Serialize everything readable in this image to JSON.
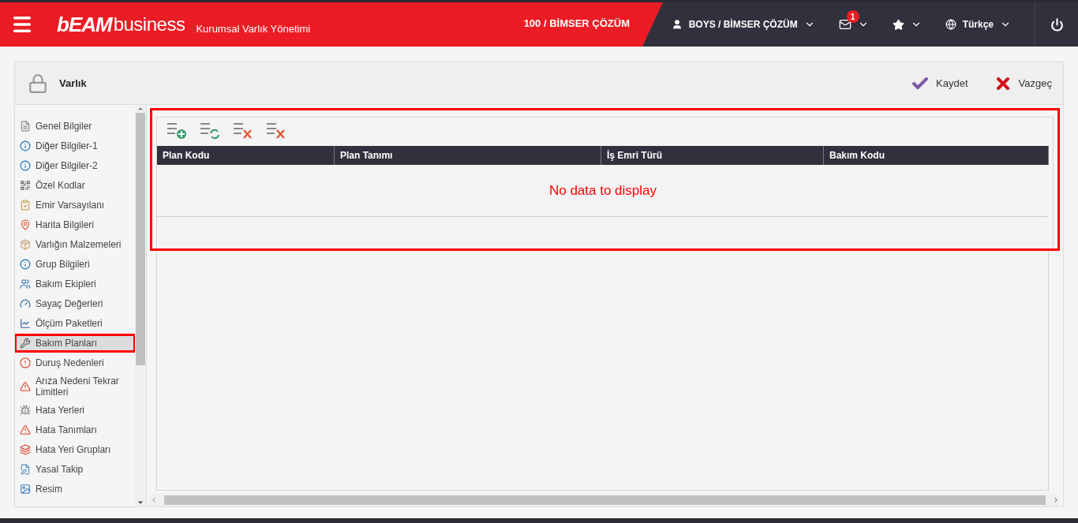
{
  "header": {
    "logo": "bEAM",
    "logo_suffix": "business",
    "app_title": "Kurumsal Varlık Yönetimi",
    "company": "100 / BİMSER ÇÖZÜM",
    "user": "BOYS / BİMSER ÇÖZÜM",
    "message_count": "1",
    "language": "Türkçe"
  },
  "form": {
    "title": "Varlık",
    "actions": [
      {
        "kind": "save",
        "label": "Kaydet"
      },
      {
        "kind": "cancel",
        "label": "Vazgeç"
      }
    ]
  },
  "sidebar": {
    "items": [
      {
        "label": "Genel Bilgiler",
        "selected": false
      },
      {
        "label": "Diğer Bilgiler-1",
        "selected": false
      },
      {
        "label": "Diğer Bilgiler-2",
        "selected": false
      },
      {
        "label": "Özel Kodlar",
        "selected": false
      },
      {
        "label": "Emir Varsayılanı",
        "selected": false
      },
      {
        "label": "Harita Bilgileri",
        "selected": false
      },
      {
        "label": "Varlığın Malzemeleri",
        "selected": false
      },
      {
        "label": "Grup Bilgileri",
        "selected": false
      },
      {
        "label": "Bakım Ekipleri",
        "selected": false
      },
      {
        "label": "Sayaç Değerleri",
        "selected": false
      },
      {
        "label": "Ölçüm Paketleri",
        "selected": false
      },
      {
        "label": "Bakım Planları",
        "selected": true
      },
      {
        "label": "Duruş Nedenleri",
        "selected": false
      },
      {
        "label": "Arıza Nedeni Tekrar Limitleri",
        "selected": false
      },
      {
        "label": "Hata Yerleri",
        "selected": false
      },
      {
        "label": "Hata Tanımları",
        "selected": false
      },
      {
        "label": "Hata Yeri Grupları",
        "selected": false
      },
      {
        "label": "Yasal Takip",
        "selected": false
      },
      {
        "label": "Resim",
        "selected": false
      }
    ]
  },
  "grid": {
    "columns": [
      "Plan Kodu",
      "Plan Tanımı",
      "İş Emri Türü",
      "Bakım Kodu"
    ],
    "empty_text": "No data to display"
  }
}
